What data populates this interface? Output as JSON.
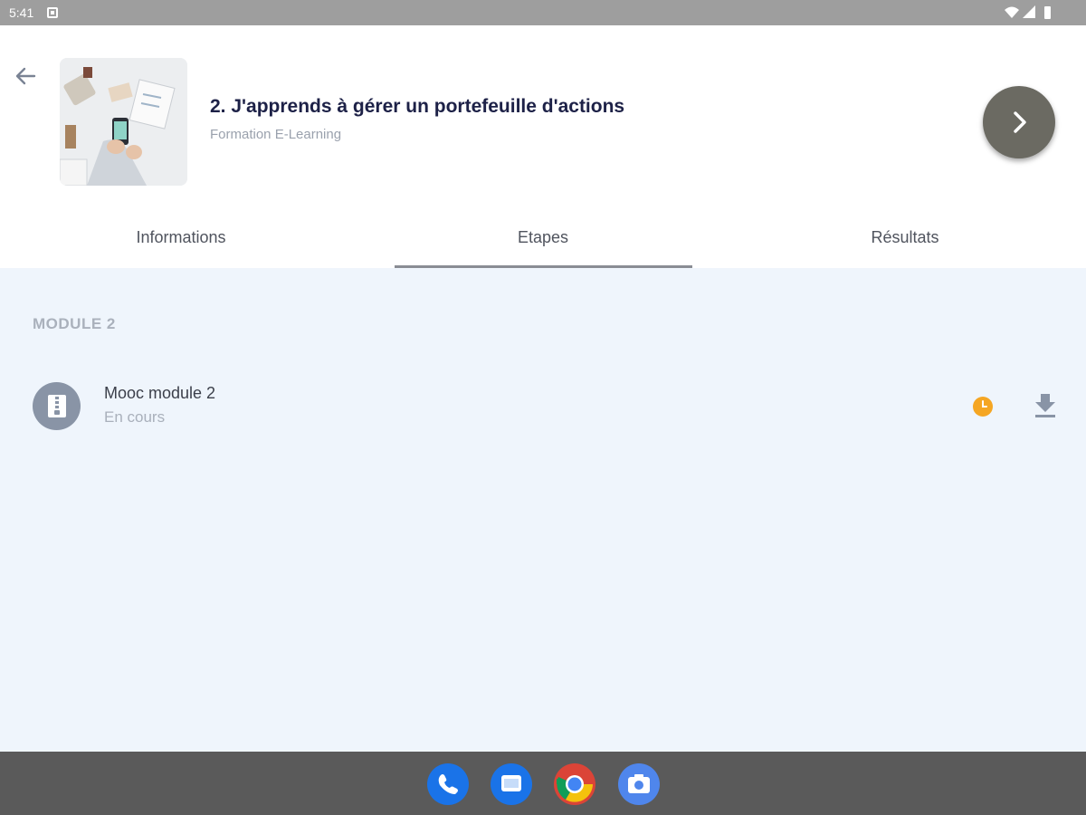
{
  "status_bar": {
    "time": "5:41"
  },
  "header": {
    "title": "2. J'apprends à gérer un portefeuille d'actions",
    "subtitle": "Formation E-Learning"
  },
  "tabs": [
    {
      "label": "Informations",
      "selected": false
    },
    {
      "label": "Etapes",
      "selected": true
    },
    {
      "label": "Résultats",
      "selected": false
    }
  ],
  "content": {
    "section_label": "MODULE 2",
    "items": [
      {
        "title": "Mooc module 2",
        "status": "En cours",
        "status_icon": "clock-icon",
        "action_icon": "download-icon"
      }
    ]
  },
  "colors": {
    "title": "#1d2147",
    "content_bg": "#eff5fc",
    "next_button": "#6b6a62",
    "clock": "#f5a623",
    "nav_bar": "#5a5a5a"
  },
  "nav_dock": [
    "phone-icon",
    "messages-icon",
    "chrome-icon",
    "camera-icon"
  ]
}
